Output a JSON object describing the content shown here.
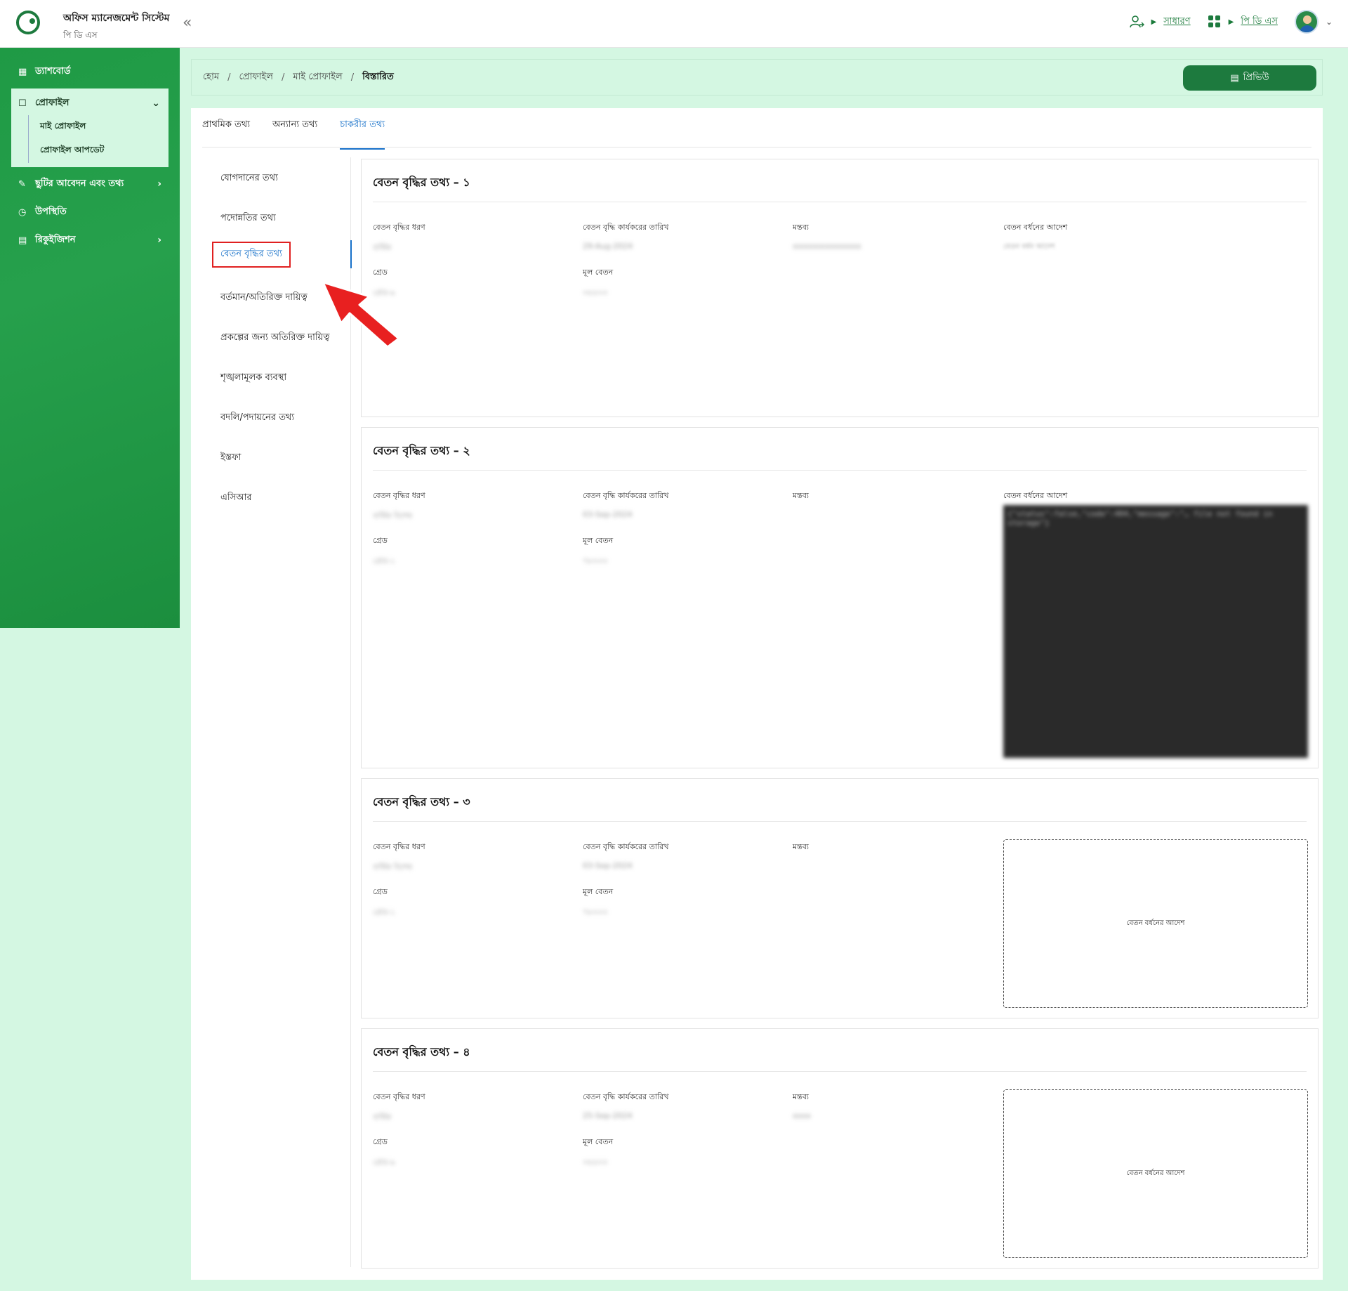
{
  "app": {
    "title": "অফিস ম্যানেজমেন্ট সিস্টেম",
    "subtitle": "পি ডি এস",
    "collapse": "«"
  },
  "topbar": {
    "role_link": "সাধারণ",
    "app_link": "পি ডি এস",
    "chevron": "⌄"
  },
  "sidebar": {
    "items": [
      {
        "label": "ড্যাশবোর্ড",
        "icon": "grid-icon"
      },
      {
        "label": "প্রোফাইল",
        "icon": "user-icon",
        "expanded": true,
        "children": [
          {
            "label": "মাই প্রোফাইল"
          },
          {
            "label": "প্রোফাইল আপডেট"
          }
        ]
      },
      {
        "label": "ছুটির আবেদন এবং তথ্য",
        "icon": "leave-icon"
      },
      {
        "label": "উপস্থিতি",
        "icon": "clock-icon"
      },
      {
        "label": "রিকুইজিশন",
        "icon": "requisition-icon"
      }
    ]
  },
  "breadcrumb": {
    "items": [
      "হোম",
      "প্রোফাইল",
      "মাই প্রোফাইল",
      "বিস্তারিত"
    ],
    "preview_label": "প্রিভিউ"
  },
  "tabs": [
    "প্রাথমিক তথ্য",
    "অন্যান্য তথ্য",
    "চাকরীর তথ্য"
  ],
  "active_tab": 2,
  "leftnav": {
    "items": [
      "যোগদানের তথ্য",
      "পদোন্নতির তথ্য",
      "বেতন বৃদ্ধির তথ্য",
      "বর্তমান/অতিরিক্ত দায়িত্ব",
      "প্রকল্পের জন্য অতিরিক্ত দায়িত্ব",
      "শৃঙ্খলামূলক ব্যবস্থা",
      "বদলি/পদায়নের তথ্য",
      "ইস্তফা",
      "এসিআর"
    ],
    "active": 2
  },
  "field_labels": {
    "type": "বেতন বৃদ্ধির ধরণ",
    "effective_date": "বেতন বৃদ্ধি কার্যকরের তারিখ",
    "remarks": "মন্তব্য",
    "order": "বেতন বর্ধনের আদেশ",
    "grade": "গ্রেড",
    "basic": "মূল বেতন"
  },
  "cards": [
    {
      "title": "বেতন বৃদ্ধির তথ্য – ১",
      "type": "বার্ষিক",
      "date": "29-Aug-2024",
      "remarks": "xxxxxxxxxxxxxxx",
      "grade": "গ্রেড-৯",
      "basic": "৩৫৫০০",
      "order_preview": "বেতন বর্ধন আদেশ"
    },
    {
      "title": "বেতন বৃদ্ধির তথ্য – ২",
      "type": "বার্ষিক বিশেষ",
      "date": "03-Sep-2024",
      "remarks": "",
      "grade": "গ্রেড-১",
      "basic": "৭৮০০০",
      "order_preview": "{\"status\":false,\"code\":404,\"message\":\"… file not found in storage\"}"
    },
    {
      "title": "বেতন বৃদ্ধির তথ্য – ৩",
      "type": "বার্ষিক বিশেষ",
      "date": "03-Sep-2024",
      "remarks": "",
      "grade": "গ্রেড-১",
      "basic": "৭৮০০০",
      "order_placeholder": "বেতন বর্ধনের আদেশ"
    },
    {
      "title": "বেতন বৃদ্ধির তথ্য – ৪",
      "type": "বার্ষিক",
      "date": "25-Sep-2024",
      "remarks": "xxxx",
      "grade": "গ্রেড-৯",
      "basic": "৩৫৫০০",
      "order_placeholder": "বেতন বর্ধনের আদেশ"
    }
  ],
  "colors": {
    "brand": "#1d7a3e",
    "accent": "#1670c9",
    "sidebar": "#26a04c",
    "highlight": "#e02020"
  }
}
